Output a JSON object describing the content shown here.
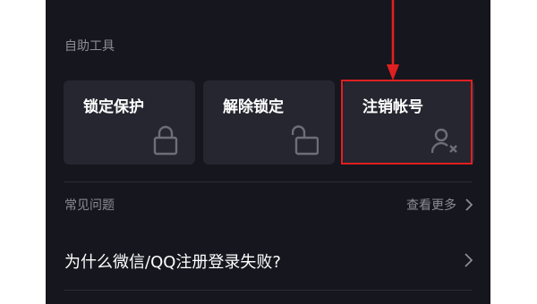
{
  "tools_section": {
    "title": "自助工具",
    "cards": [
      {
        "label": "锁定保护",
        "icon": "lock-icon"
      },
      {
        "label": "解除锁定",
        "icon": "unlock-icon"
      },
      {
        "label": "注销帐号",
        "icon": "user-remove-icon"
      }
    ]
  },
  "faq_section": {
    "title": "常见问题",
    "see_more_label": "查看更多",
    "items": [
      {
        "question": "为什么微信/QQ注册登录失败?"
      }
    ]
  },
  "annotation": {
    "highlight_color": "#e02020"
  },
  "colors": {
    "background": "#16161e",
    "card": "#262630",
    "muted_text": "#8c8c95",
    "text": "#ffffff"
  }
}
